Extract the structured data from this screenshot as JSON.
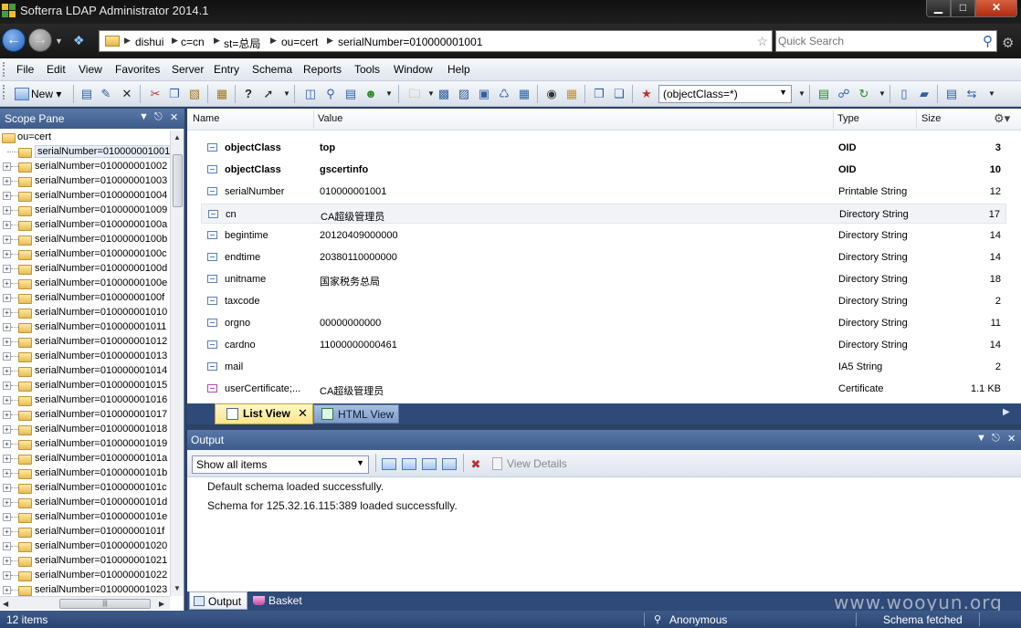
{
  "window": {
    "title": "Softerra LDAP Administrator 2014.1",
    "min_glyph": "▁",
    "max_glyph": "□",
    "close_glyph": "✕"
  },
  "address": {
    "crumbs": [
      "dishui",
      "c=cn",
      "st=总局",
      "ou=cert",
      "serialNumber=010000001001"
    ],
    "search_placeholder": "Quick Search"
  },
  "menu": [
    "File",
    "Edit",
    "View",
    "Favorites",
    "Server",
    "Entry",
    "Schema",
    "Reports",
    "Tools",
    "Window",
    "Help"
  ],
  "toolbar": {
    "new_label": "New",
    "filter_value": "(objectClass=*)"
  },
  "scope": {
    "title": "Scope Pane",
    "root": "ou=cert",
    "items": [
      "serialNumber=010000001001",
      "serialNumber=010000001002",
      "serialNumber=010000001003",
      "serialNumber=010000001004",
      "serialNumber=010000001009",
      "serialNumber=01000000100a",
      "serialNumber=01000000100b",
      "serialNumber=01000000100c",
      "serialNumber=01000000100d",
      "serialNumber=01000000100e",
      "serialNumber=01000000100f",
      "serialNumber=010000001010",
      "serialNumber=010000001011",
      "serialNumber=010000001012",
      "serialNumber=010000001013",
      "serialNumber=010000001014",
      "serialNumber=010000001015",
      "serialNumber=010000001016",
      "serialNumber=010000001017",
      "serialNumber=010000001018",
      "serialNumber=010000001019",
      "serialNumber=01000000101a",
      "serialNumber=01000000101b",
      "serialNumber=01000000101c",
      "serialNumber=01000000101d",
      "serialNumber=01000000101e",
      "serialNumber=01000000101f",
      "serialNumber=010000001020",
      "serialNumber=010000001021",
      "serialNumber=010000001022",
      "serialNumber=010000001023"
    ]
  },
  "list": {
    "columns": {
      "name": "Name",
      "value": "Value",
      "type": "Type",
      "size": "Size"
    },
    "rows": [
      {
        "name": "objectClass",
        "value": "top",
        "type": "OID",
        "size": "3",
        "bold": true
      },
      {
        "name": "objectClass",
        "value": "gscertinfo",
        "type": "OID",
        "size": "10",
        "bold": true
      },
      {
        "name": "serialNumber",
        "value": "010000001001",
        "type": "Printable String",
        "size": "12"
      },
      {
        "name": "cn",
        "value": "CA超级管理员",
        "type": "Directory String",
        "size": "17",
        "selected": true
      },
      {
        "name": "begintime",
        "value": "20120409000000",
        "type": "Directory String",
        "size": "14"
      },
      {
        "name": "endtime",
        "value": "20380110000000",
        "type": "Directory String",
        "size": "14"
      },
      {
        "name": "unitname",
        "value": "国家税务总局",
        "type": "Directory String",
        "size": "18"
      },
      {
        "name": "taxcode",
        "value": "",
        "type": "Directory String",
        "size": "2"
      },
      {
        "name": "orgno",
        "value": "00000000000",
        "type": "Directory String",
        "size": "11"
      },
      {
        "name": "cardno",
        "value": "11000000000461",
        "type": "Directory String",
        "size": "14"
      },
      {
        "name": "mail",
        "value": "",
        "type": "IA5 String",
        "size": "2"
      },
      {
        "name": "userCertificate;...",
        "value": "CA超级管理员",
        "type": "Certificate",
        "size": "1.1 KB",
        "cert": true
      }
    ]
  },
  "view_tabs": {
    "list": "List View",
    "html": "HTML View"
  },
  "output": {
    "title": "Output",
    "show_value": "Show all items",
    "view_details": "View Details",
    "lines": [
      "Default schema loaded successfully.",
      "Schema for 125.32.16.115:389 loaded successfully."
    ]
  },
  "bottom_tabs": {
    "output": "Output",
    "basket": "Basket"
  },
  "watermark": "www.wooyun.org",
  "status": {
    "items": "12 items",
    "user": "Anonymous",
    "schema": "Schema fetched"
  }
}
